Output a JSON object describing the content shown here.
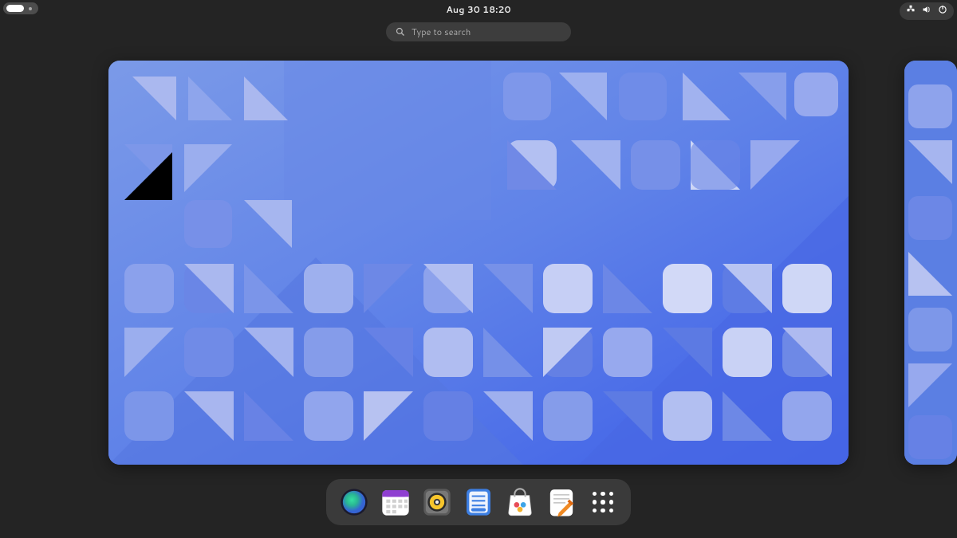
{
  "topbar": {
    "date_time": "Aug 30  18:20",
    "status_icons": [
      "network-icon",
      "volume-icon",
      "power-icon"
    ]
  },
  "search": {
    "placeholder": "Type to search"
  },
  "dock": {
    "apps": [
      {
        "name": "web-browser",
        "label": "Web"
      },
      {
        "name": "calendar",
        "label": "Calendar"
      },
      {
        "name": "music",
        "label": "Rhythmbox"
      },
      {
        "name": "todo",
        "label": "To Do"
      },
      {
        "name": "software",
        "label": "Software"
      },
      {
        "name": "text-editor",
        "label": "Text Editor"
      },
      {
        "name": "show-apps",
        "label": "Show Apps"
      }
    ]
  }
}
